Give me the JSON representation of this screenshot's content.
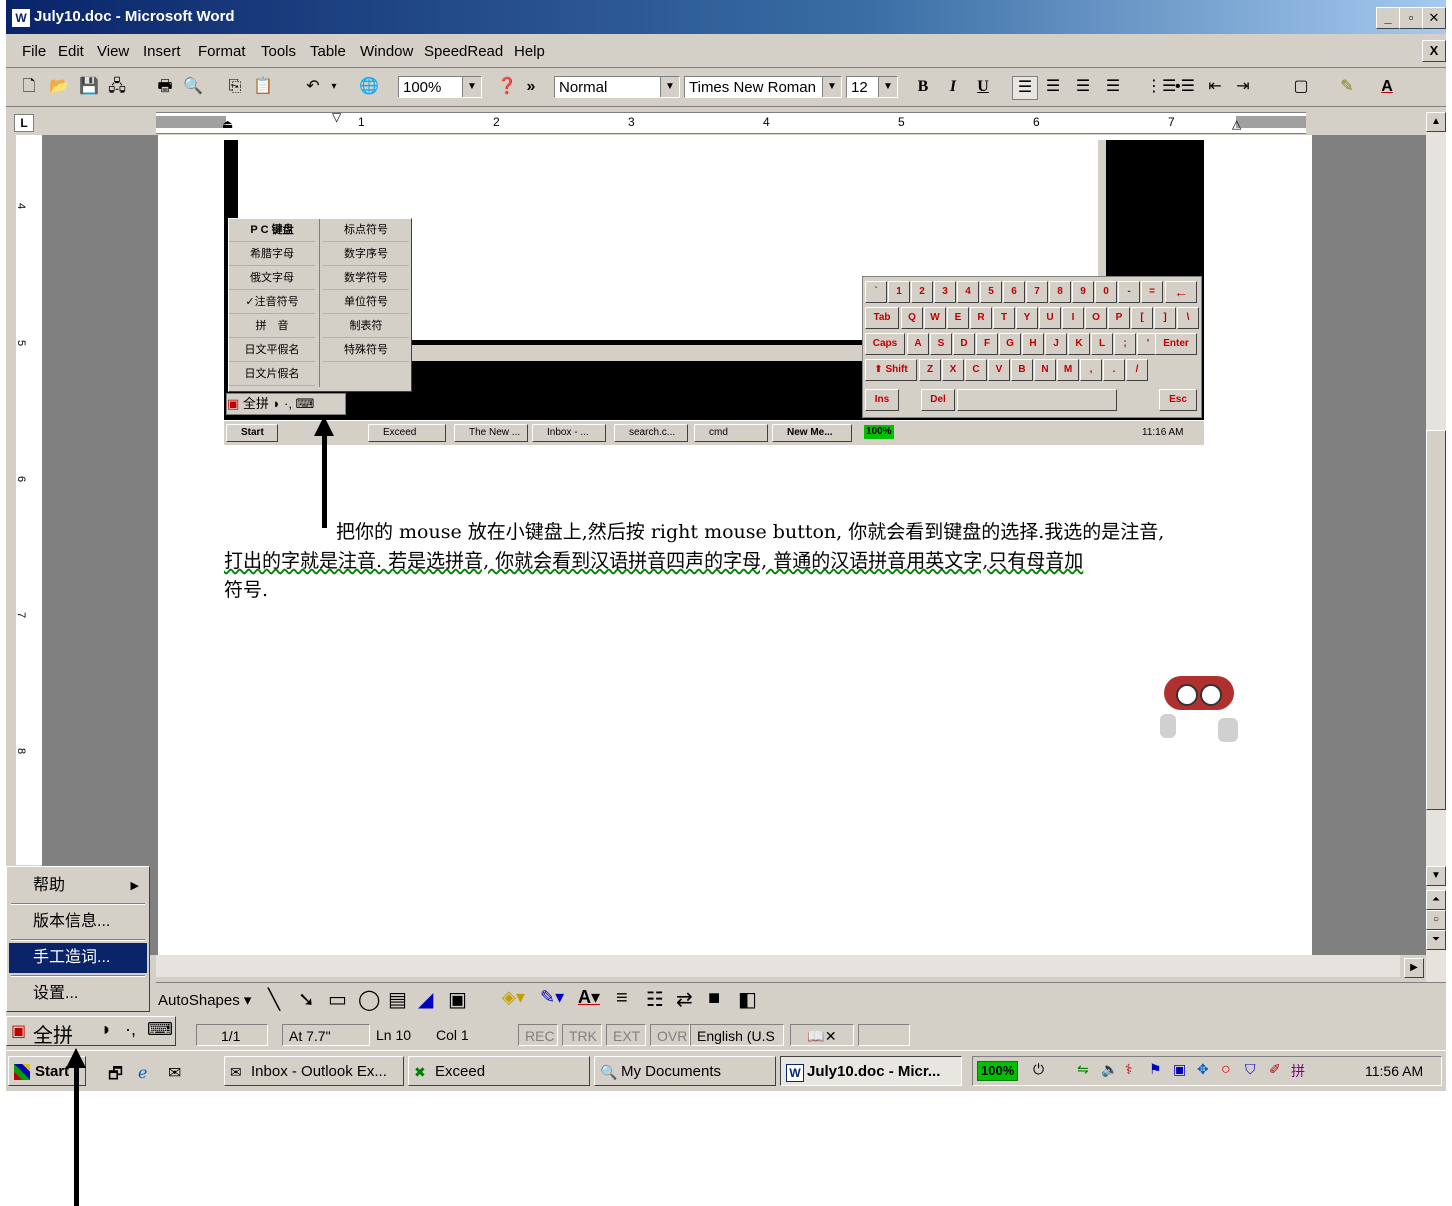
{
  "window": {
    "title": "July10.doc - Microsoft Word",
    "app_icon": "word-doc-icon",
    "buttons": [
      "_",
      "̸",
      "X"
    ]
  },
  "menubar": {
    "items": [
      "File",
      "Edit",
      "View",
      "Insert",
      "Format",
      "Tools",
      "Table",
      "Window",
      "SpeedRead",
      "Help"
    ],
    "close_label": "X"
  },
  "toolbar": {
    "zoom": "100%",
    "style": "Normal",
    "font": "Times New Roman",
    "size": "12",
    "bold": "B",
    "italic": "I",
    "underline": "U",
    "more": "»"
  },
  "ruler": {
    "tab_selector": "L",
    "numbers": [
      "1",
      "2",
      "3",
      "4",
      "5",
      "6",
      "7"
    ],
    "vertical_numbers": [
      "4",
      "5",
      "6",
      "7",
      "8"
    ]
  },
  "embedded_screenshot": {
    "context_menu": [
      [
        "P C 键盘",
        "标点符号"
      ],
      [
        "希腊字母",
        "数字序号"
      ],
      [
        "俄文字母",
        "数学符号"
      ],
      [
        "✓注音符号",
        "单位符号"
      ],
      [
        "拼　音",
        "制表符"
      ],
      [
        "日文平假名",
        "特殊符号"
      ],
      [
        "日文片假名",
        ""
      ]
    ],
    "ime_bar": "全拼",
    "taskbar": [
      "Start",
      "Exceed",
      "The New ...",
      "Inbox - ...",
      "search.c...",
      "cmd",
      "New Me..."
    ],
    "tray_zoom": "100%",
    "tray_time": "11:16 AM",
    "keyboard": {
      "row1": [
        "`",
        "1",
        "2",
        "3",
        "4",
        "5",
        "6",
        "7",
        "8",
        "9",
        "0",
        "-",
        "="
      ],
      "row2": [
        "Q",
        "W",
        "E",
        "R",
        "T",
        "Y",
        "U",
        "I",
        "O",
        "P",
        "[",
        "]",
        "\\"
      ],
      "row3": [
        "A",
        "S",
        "D",
        "F",
        "G",
        "H",
        "J",
        "K",
        "L",
        ";",
        "'"
      ],
      "row4": [
        "Z",
        "X",
        "C",
        "V",
        "B",
        "N",
        "M",
        ",",
        ".",
        "/"
      ],
      "tab": "Tab",
      "caps": "Caps",
      "shift": "Shift",
      "enter": "Enter",
      "ins": "Ins",
      "del": "Del",
      "esc": "Esc",
      "backspace": "←"
    }
  },
  "document": {
    "paragraph_line1": "把你的 mouse 放在小键盘上,然后按 right mouse button, 你就会看到键盘的选择.我选的是注音,",
    "paragraph_line2": "打出的字就是注音. 若是选拼音, 你就会看到汉语拼音四声的字母, 普通的汉语拼音用英文字,只有母音加",
    "paragraph_line3": "符号."
  },
  "ime_popup_menu": {
    "items": [
      "帮助",
      "版本信息...",
      "手工造词...",
      "设置..."
    ],
    "selected_index": 2
  },
  "ime_status_bar": {
    "label": "全拼"
  },
  "drawing_toolbar": {
    "autoshapes": "AutoShapes"
  },
  "statusbar": {
    "page": "1/1",
    "at": "At 7.7\"",
    "ln": "Ln 10",
    "col": "Col 1",
    "rec": "REC",
    "trk": "TRK",
    "ext": "EXT",
    "ovr": "OVR",
    "lang": "English (U.S"
  },
  "taskbar": {
    "start": "Start",
    "tasks": [
      "Inbox - Outlook Ex...",
      "Exceed",
      "My Documents",
      "July10.doc - Micr..."
    ],
    "tray_zoom": "100%",
    "time": "11:56 AM"
  },
  "colors": {
    "title_start": "#0a246a",
    "title_end": "#a6caf0",
    "face": "#d4d0c8",
    "menu_highlight": "#0a246a",
    "keyboard_label": "#c00000"
  }
}
